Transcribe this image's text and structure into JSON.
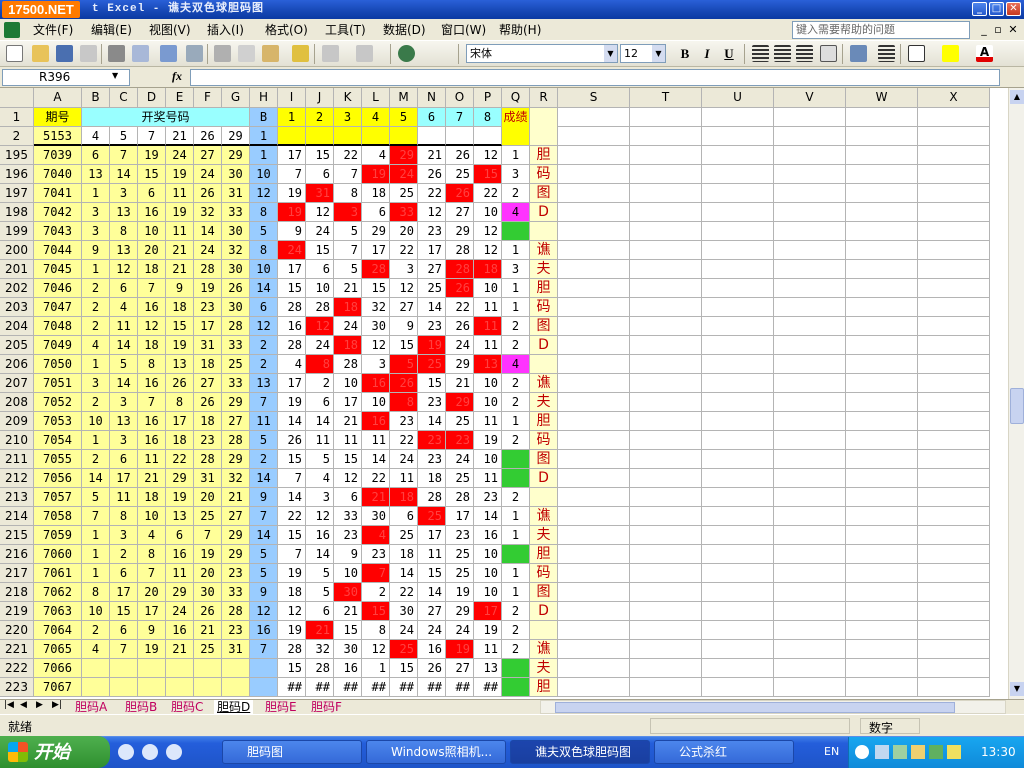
{
  "window": {
    "watermark": "17500.NET",
    "title": "t Excel - 谯夫双色球胆码图"
  },
  "menu": [
    "文件(F)",
    "编辑(E)",
    "视图(V)",
    "插入(I)",
    "格式(O)",
    "工具(T)",
    "数据(D)",
    "窗口(W)",
    "帮助(H)"
  ],
  "help_placeholder": "键入需要帮助的问题",
  "toolbar": {
    "font_name": "宋体",
    "font_size": "12",
    "bold": "B",
    "italic": "I",
    "underline": "U"
  },
  "name_box": "R396",
  "fx_label": "fx",
  "columns": [
    "A",
    "B",
    "C",
    "D",
    "E",
    "F",
    "G",
    "H",
    "I",
    "J",
    "K",
    "L",
    "M",
    "N",
    "O",
    "P",
    "Q",
    "R",
    "S",
    "T",
    "U",
    "V",
    "W",
    "X"
  ],
  "header_rows": {
    "row1": {
      "num": "1",
      "A": "期号",
      "B_to_G": "开奖号码",
      "H": "B",
      "I_to_P": [
        "1",
        "2",
        "3",
        "4",
        "5",
        "6",
        "7",
        "8"
      ],
      "Q": "成绩"
    },
    "row2": {
      "num": "2",
      "A": "5153",
      "B_to_G": [
        "4",
        "5",
        "7",
        "21",
        "26",
        "29"
      ],
      "H": "1"
    }
  },
  "rows": [
    {
      "num": "195",
      "issue": "7039",
      "draw": [
        "6",
        "7",
        "19",
        "24",
        "27",
        "29"
      ],
      "blue": "1",
      "cols": [
        "17",
        "15",
        "22",
        "4",
        "29",
        "21",
        "26",
        "12"
      ],
      "score": "1",
      "side": "胆"
    },
    {
      "num": "196",
      "issue": "7040",
      "draw": [
        "13",
        "14",
        "15",
        "19",
        "24",
        "30"
      ],
      "blue": "10",
      "cols": [
        "7",
        "6",
        "7",
        "19",
        "24",
        "26",
        "25",
        "15"
      ],
      "score": "3",
      "side": "码"
    },
    {
      "num": "197",
      "issue": "7041",
      "draw": [
        "1",
        "3",
        "6",
        "11",
        "26",
        "31"
      ],
      "blue": "12",
      "cols": [
        "19",
        "31",
        "8",
        "18",
        "25",
        "22",
        "26",
        "22"
      ],
      "score": "2",
      "side": "图"
    },
    {
      "num": "198",
      "issue": "7042",
      "draw": [
        "3",
        "13",
        "16",
        "19",
        "32",
        "33"
      ],
      "blue": "8",
      "cols": [
        "19",
        "12",
        "3",
        "6",
        "33",
        "12",
        "27",
        "10"
      ],
      "score": "4",
      "side": "D"
    },
    {
      "num": "199",
      "issue": "7043",
      "draw": [
        "3",
        "8",
        "10",
        "11",
        "14",
        "30"
      ],
      "blue": "5",
      "cols": [
        "9",
        "24",
        "5",
        "29",
        "20",
        "23",
        "29",
        "12"
      ],
      "score": "",
      "side": ""
    },
    {
      "num": "200",
      "issue": "7044",
      "draw": [
        "9",
        "13",
        "20",
        "21",
        "24",
        "32"
      ],
      "blue": "8",
      "cols": [
        "24",
        "15",
        "7",
        "17",
        "22",
        "17",
        "28",
        "12"
      ],
      "score": "1",
      "side": "谯"
    },
    {
      "num": "201",
      "issue": "7045",
      "draw": [
        "1",
        "12",
        "18",
        "21",
        "28",
        "30"
      ],
      "blue": "10",
      "cols": [
        "17",
        "6",
        "5",
        "28",
        "3",
        "27",
        "28",
        "18"
      ],
      "score": "3",
      "side": "夫"
    },
    {
      "num": "202",
      "issue": "7046",
      "draw": [
        "2",
        "6",
        "7",
        "9",
        "19",
        "26"
      ],
      "blue": "14",
      "cols": [
        "15",
        "10",
        "21",
        "15",
        "12",
        "25",
        "26",
        "10"
      ],
      "score": "1",
      "side": "胆"
    },
    {
      "num": "203",
      "issue": "7047",
      "draw": [
        "2",
        "4",
        "16",
        "18",
        "23",
        "30"
      ],
      "blue": "6",
      "cols": [
        "28",
        "28",
        "18",
        "32",
        "27",
        "14",
        "22",
        "11"
      ],
      "score": "1",
      "side": "码"
    },
    {
      "num": "204",
      "issue": "7048",
      "draw": [
        "2",
        "11",
        "12",
        "15",
        "17",
        "28"
      ],
      "blue": "12",
      "cols": [
        "16",
        "12",
        "24",
        "30",
        "9",
        "23",
        "26",
        "11"
      ],
      "score": "2",
      "side": "图"
    },
    {
      "num": "205",
      "issue": "7049",
      "draw": [
        "4",
        "14",
        "18",
        "19",
        "31",
        "33"
      ],
      "blue": "2",
      "cols": [
        "28",
        "24",
        "18",
        "12",
        "15",
        "19",
        "24",
        "11"
      ],
      "score": "2",
      "side": "D"
    },
    {
      "num": "206",
      "issue": "7050",
      "draw": [
        "1",
        "5",
        "8",
        "13",
        "18",
        "25"
      ],
      "blue": "2",
      "cols": [
        "4",
        "8",
        "28",
        "3",
        "5",
        "25",
        "29",
        "13"
      ],
      "score": "4",
      "side": ""
    },
    {
      "num": "207",
      "issue": "7051",
      "draw": [
        "3",
        "14",
        "16",
        "26",
        "27",
        "33"
      ],
      "blue": "13",
      "cols": [
        "17",
        "2",
        "10",
        "16",
        "26",
        "15",
        "21",
        "10"
      ],
      "score": "2",
      "side": "谯"
    },
    {
      "num": "208",
      "issue": "7052",
      "draw": [
        "2",
        "3",
        "7",
        "8",
        "26",
        "29"
      ],
      "blue": "7",
      "cols": [
        "19",
        "6",
        "17",
        "10",
        "8",
        "23",
        "29",
        "10"
      ],
      "score": "2",
      "side": "夫"
    },
    {
      "num": "209",
      "issue": "7053",
      "draw": [
        "10",
        "13",
        "16",
        "17",
        "18",
        "27"
      ],
      "blue": "11",
      "cols": [
        "14",
        "14",
        "21",
        "16",
        "23",
        "14",
        "25",
        "11"
      ],
      "score": "1",
      "side": "胆"
    },
    {
      "num": "210",
      "issue": "7054",
      "draw": [
        "1",
        "3",
        "16",
        "18",
        "23",
        "28"
      ],
      "blue": "5",
      "cols": [
        "26",
        "11",
        "11",
        "11",
        "22",
        "23",
        "23",
        "19"
      ],
      "score": "2",
      "side": "码"
    },
    {
      "num": "211",
      "issue": "7055",
      "draw": [
        "2",
        "6",
        "11",
        "22",
        "28",
        "29"
      ],
      "blue": "2",
      "cols": [
        "15",
        "5",
        "15",
        "14",
        "24",
        "23",
        "24",
        "10"
      ],
      "score": "",
      "side": "图"
    },
    {
      "num": "212",
      "issue": "7056",
      "draw": [
        "14",
        "17",
        "21",
        "29",
        "31",
        "32"
      ],
      "blue": "14",
      "cols": [
        "7",
        "4",
        "12",
        "22",
        "11",
        "18",
        "25",
        "11"
      ],
      "score": "",
      "side": "D"
    },
    {
      "num": "213",
      "issue": "7057",
      "draw": [
        "5",
        "11",
        "18",
        "19",
        "20",
        "21"
      ],
      "blue": "9",
      "cols": [
        "14",
        "3",
        "6",
        "21",
        "18",
        "28",
        "28",
        "23"
      ],
      "score": "2",
      "side": ""
    },
    {
      "num": "214",
      "issue": "7058",
      "draw": [
        "7",
        "8",
        "10",
        "13",
        "25",
        "27"
      ],
      "blue": "7",
      "cols": [
        "22",
        "12",
        "33",
        "30",
        "6",
        "25",
        "17",
        "14"
      ],
      "score": "1",
      "side": "谯"
    },
    {
      "num": "215",
      "issue": "7059",
      "draw": [
        "1",
        "3",
        "4",
        "6",
        "7",
        "29"
      ],
      "blue": "14",
      "cols": [
        "15",
        "16",
        "23",
        "4",
        "25",
        "17",
        "23",
        "16"
      ],
      "score": "1",
      "side": "夫"
    },
    {
      "num": "216",
      "issue": "7060",
      "draw": [
        "1",
        "2",
        "8",
        "16",
        "19",
        "29"
      ],
      "blue": "5",
      "cols": [
        "7",
        "14",
        "9",
        "23",
        "18",
        "11",
        "25",
        "10"
      ],
      "score": "",
      "side": "胆"
    },
    {
      "num": "217",
      "issue": "7061",
      "draw": [
        "1",
        "6",
        "7",
        "11",
        "20",
        "23"
      ],
      "blue": "5",
      "cols": [
        "19",
        "5",
        "10",
        "7",
        "14",
        "15",
        "25",
        "10"
      ],
      "score": "1",
      "side": "码"
    },
    {
      "num": "218",
      "issue": "7062",
      "draw": [
        "8",
        "17",
        "20",
        "29",
        "30",
        "33"
      ],
      "blue": "9",
      "cols": [
        "18",
        "5",
        "30",
        "2",
        "22",
        "14",
        "19",
        "10"
      ],
      "score": "1",
      "side": "图"
    },
    {
      "num": "219",
      "issue": "7063",
      "draw": [
        "10",
        "15",
        "17",
        "24",
        "26",
        "28"
      ],
      "blue": "12",
      "cols": [
        "12",
        "6",
        "21",
        "15",
        "30",
        "27",
        "29",
        "17"
      ],
      "score": "2",
      "side": "D"
    },
    {
      "num": "220",
      "issue": "7064",
      "draw": [
        "2",
        "6",
        "9",
        "16",
        "21",
        "23"
      ],
      "blue": "16",
      "cols": [
        "19",
        "21",
        "15",
        "8",
        "24",
        "24",
        "24",
        "19"
      ],
      "score": "2",
      "side": ""
    },
    {
      "num": "221",
      "issue": "7065",
      "draw": [
        "4",
        "7",
        "19",
        "21",
        "25",
        "31"
      ],
      "blue": "7",
      "cols": [
        "28",
        "32",
        "30",
        "12",
        "25",
        "16",
        "19",
        "11"
      ],
      "score": "2",
      "side": "谯"
    },
    {
      "num": "222",
      "issue": "7066",
      "draw": [
        "",
        "",
        "",
        "",
        "",
        ""
      ],
      "blue": "",
      "cols": [
        "15",
        "28",
        "16",
        "1",
        "15",
        "26",
        "27",
        "13"
      ],
      "score": "",
      "side": "夫"
    },
    {
      "num": "223",
      "issue": "7067",
      "draw": [
        "",
        "",
        "",
        "",
        "",
        ""
      ],
      "blue": "",
      "cols": [
        "##",
        "##",
        "##",
        "##",
        "##",
        "##",
        "##",
        "##"
      ],
      "score": "",
      "side": "胆"
    }
  ],
  "tabs": [
    "胆码A",
    "胆码B",
    "胆码C",
    "胆码D",
    "胆码E",
    "胆码F"
  ],
  "active_tab": "胆码D",
  "status": {
    "left": "就绪",
    "mode": "数字"
  },
  "taskbar": {
    "start": "开始",
    "tasks": [
      "胆码图",
      "Windows照相机...",
      "谯夫双色球胆码图",
      "公式杀红"
    ],
    "lang": "EN",
    "clock": "13:30"
  },
  "colors": {
    "hit_red": "#ff0000",
    "issue_yellow": "#ffff99",
    "blue_col": "#99ccff",
    "score_green": "#33cc33",
    "score_magenta": "#ff33ff",
    "side_text": "#c00000",
    "header_yellow": "#ffff00",
    "header_cyan": "#99ffff"
  }
}
